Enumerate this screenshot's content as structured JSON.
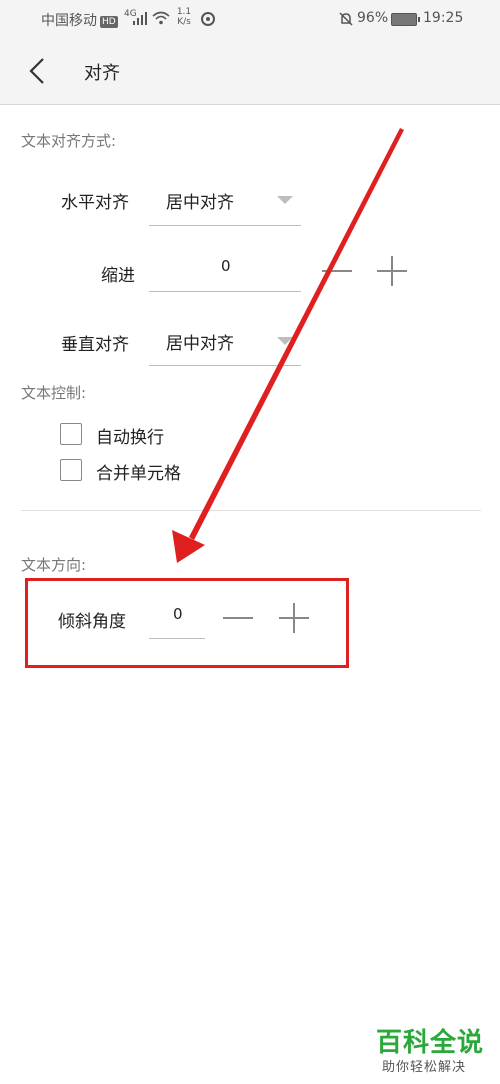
{
  "status_bar": {
    "carrier": "中国移动",
    "hd": "HD",
    "network": "4G",
    "speed_top": "1.1",
    "speed_bottom": "K/s",
    "battery": "96%",
    "time": "19:25"
  },
  "header": {
    "title": "对齐"
  },
  "alignment": {
    "section_label": "文本对齐方式:",
    "horizontal_label": "水平对齐",
    "horizontal_value": "居中对齐",
    "indent_label": "缩进",
    "indent_value": "0",
    "vertical_label": "垂直对齐",
    "vertical_value": "居中对齐"
  },
  "text_control": {
    "section_label": "文本控制:",
    "wrap_label": "自动换行",
    "merge_label": "合并单元格"
  },
  "direction": {
    "section_label": "文本方向:",
    "angle_label": "倾斜角度",
    "angle_value": "0"
  },
  "watermark": {
    "title": "百科全说",
    "subtitle": "助你轻松解决"
  },
  "colors": {
    "annotation": "#e02020",
    "watermark": "#2ba83a"
  }
}
